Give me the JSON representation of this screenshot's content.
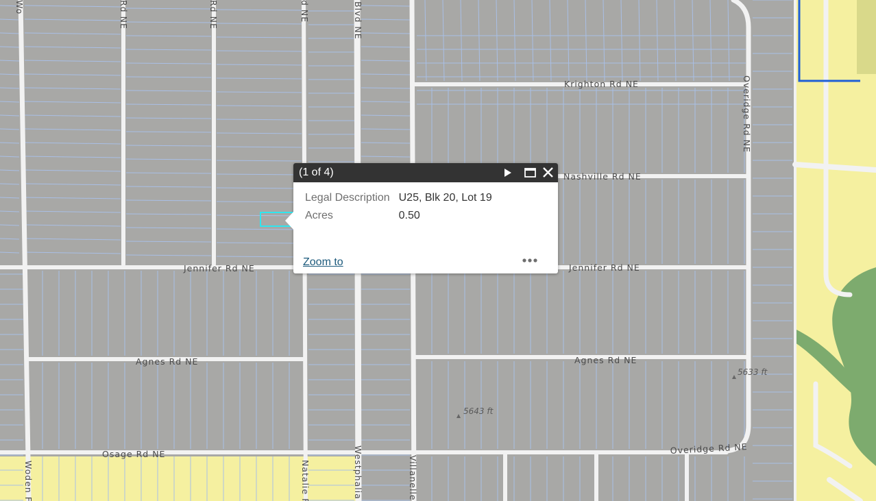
{
  "map": {
    "road_labels": [
      "Krighton Rd NE",
      "Nashville Rd NE",
      "Jennifer Rd NE",
      "Jennifer Rd NE",
      "Agnes Rd NE",
      "Agnes Rd NE",
      "Osage Rd NE",
      "Overidge Rd NE",
      "Overidge Rd NE",
      "Westphalia",
      "Villanelle",
      "Natalie F",
      "Woden F",
      "Blvd NE",
      "Rd NE",
      "Rd NE",
      "d NE",
      "Wo"
    ],
    "elevation_labels": [
      "5633 ft",
      "5643 ft"
    ],
    "colors": {
      "parcel_fill": "#a8a8a6",
      "road": "#f2f2f2",
      "parcel_line": "#a9bfe6",
      "zone_yellow": "#f5f0a0",
      "park_green": "#7dab6e",
      "boundary_blue": "#1e5fd6",
      "selection_cyan": "#2ee6f0"
    }
  },
  "popup": {
    "title": "(1 of 4)",
    "fields": [
      {
        "label": "Legal Description",
        "value": "U25, Blk 20, Lot 19"
      },
      {
        "label": "Acres",
        "value": "0.50"
      }
    ],
    "zoom_label": "Zoom to",
    "icons": [
      "play-icon",
      "maximize-icon",
      "close-icon",
      "ellipsis-icon"
    ]
  }
}
